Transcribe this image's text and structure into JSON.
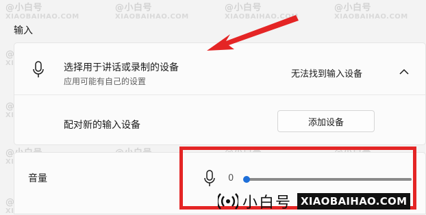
{
  "section_title": "输入",
  "device_select": {
    "title": "选择用于讲话或录制的设备",
    "subtitle": "应用可能有自己的设置",
    "status": "无法找到输入设备",
    "icon": "microphone-icon",
    "expand_icon": "chevron-up-icon"
  },
  "pair_device": {
    "label": "配对新的输入设备",
    "button_label": "添加设备"
  },
  "volume": {
    "label": "音量",
    "value": "0",
    "level": 0,
    "icon": "microphone-icon"
  },
  "watermark": {
    "handle": "@小白号",
    "domain": "XIAOBAIHAO.COM"
  },
  "brand": {
    "name": "小白号",
    "url": "XIAOBAIHAO.COM"
  },
  "annotation": {
    "highlight_color": "#e42525",
    "arrow_color": "#e42525"
  },
  "accent_color": "#1e6fd9"
}
